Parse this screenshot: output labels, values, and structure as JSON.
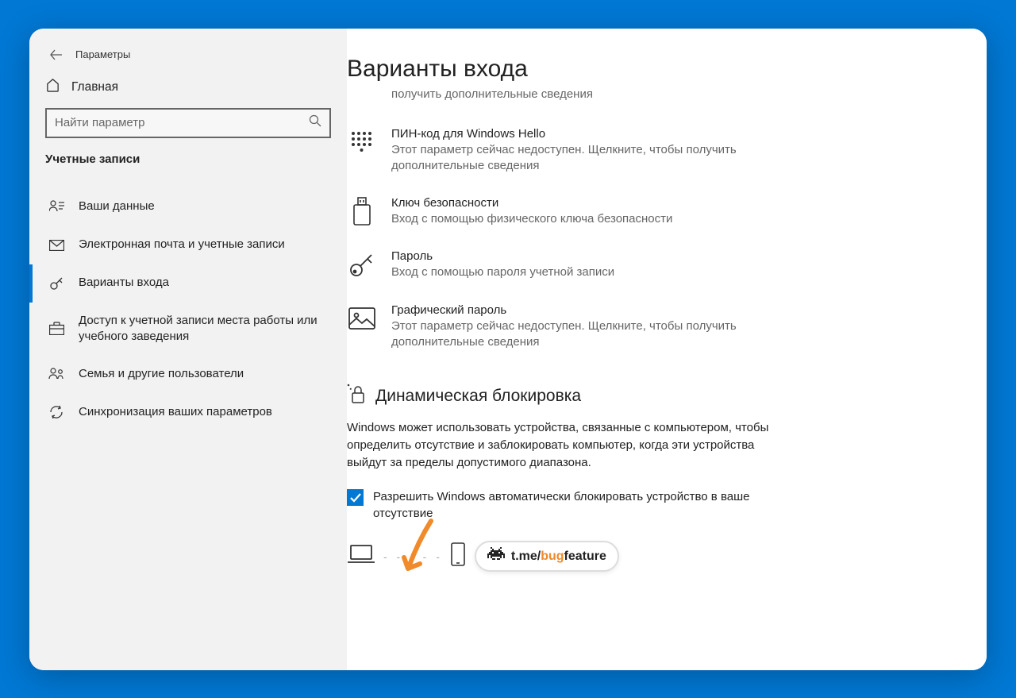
{
  "app": {
    "title": "Параметры"
  },
  "home": {
    "label": "Главная"
  },
  "search": {
    "placeholder": "Найти параметр"
  },
  "section": {
    "label": "Учетные записи"
  },
  "sidebar": {
    "items": [
      {
        "label": "Ваши данные"
      },
      {
        "label": "Электронная почта и учетные записи"
      },
      {
        "label": "Варианты входа"
      },
      {
        "label": "Доступ к учетной записи места работы или учебного заведения"
      },
      {
        "label": "Семья и другие пользователи"
      },
      {
        "label": "Синхронизация ваших параметров"
      }
    ]
  },
  "main": {
    "title": "Варианты входа",
    "cutoff": "получить дополнительные сведения",
    "options": [
      {
        "id": "pin",
        "title": "ПИН-код для Windows Hello",
        "desc": "Этот параметр сейчас недоступен. Щелкните, чтобы получить дополнительные сведения"
      },
      {
        "id": "security-key",
        "title": "Ключ безопасности",
        "desc": "Вход с помощью физического ключа безопасности"
      },
      {
        "id": "password",
        "title": "Пароль",
        "desc": "Вход с помощью пароля учетной записи"
      },
      {
        "id": "picture-password",
        "title": "Графический пароль",
        "desc": "Этот параметр сейчас недоступен. Щелкните, чтобы получить дополнительные сведения"
      }
    ],
    "dynamic_lock": {
      "heading": "Динамическая блокировка",
      "desc": "Windows может использовать устройства, связанные с компьютером, чтобы определить отсутствие и заблокировать компьютер, когда эти устройства выйдут за пределы допустимого диапазона.",
      "checkbox_label": "Разрешить Windows автоматически блокировать устройство в ваше отсутствие",
      "checked": true
    }
  },
  "watermark": {
    "prefix": "t.me/",
    "bug": "bug",
    "feature": "feature"
  },
  "colors": {
    "accent": "#0078d4",
    "arrow": "#f08a2a"
  }
}
